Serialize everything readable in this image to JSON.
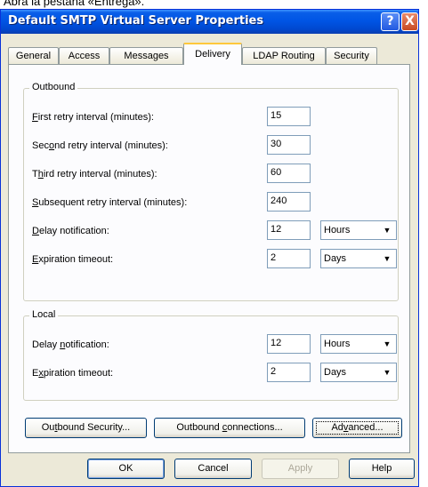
{
  "caption": "Abra la pestaña «Entrega».",
  "window": {
    "title": "Default SMTP Virtual Server Properties",
    "help_glyph": "?",
    "close_glyph": "X"
  },
  "tabs": [
    "General",
    "Access",
    "Messages",
    "Delivery",
    "LDAP Routing",
    "Security"
  ],
  "active_tab": "Delivery",
  "outbound": {
    "group_label": "Outbound",
    "first_retry": {
      "label_u": "F",
      "label_rest": "irst retry interval (minutes):",
      "value": "15"
    },
    "second_retry": {
      "label_pre": "Sec",
      "label_u": "o",
      "label_rest": "nd retry interval (minutes):",
      "value": "30"
    },
    "third_retry": {
      "label_pre": "T",
      "label_u": "h",
      "label_rest": "ird retry interval (minutes):",
      "value": "60"
    },
    "subsequent_retry": {
      "label_u": "S",
      "label_rest": "ubsequent retry interval (minutes):",
      "value": "240"
    },
    "delay_notification": {
      "label_u": "D",
      "label_rest": "elay notification:",
      "value": "12",
      "unit": "Hours"
    },
    "expiration_timeout": {
      "label_u": "E",
      "label_rest": "xpiration timeout:",
      "value": "2",
      "unit": "Days"
    }
  },
  "local": {
    "group_label": "Local",
    "delay_notification": {
      "label_pre": "Delay ",
      "label_u": "n",
      "label_rest": "otification:",
      "value": "12",
      "unit": "Hours"
    },
    "expiration_timeout": {
      "label_pre": "E",
      "label_u": "x",
      "label_rest": "piration timeout:",
      "value": "2",
      "unit": "Days"
    }
  },
  "panel_buttons": {
    "outbound_security": {
      "pre": "Ou",
      "u": "t",
      "rest": "bound Security..."
    },
    "outbound_connections": {
      "pre": "Outbound ",
      "u": "c",
      "rest": "onnections..."
    },
    "advanced": {
      "pre": "Ad",
      "u": "v",
      "rest": "anced..."
    }
  },
  "dialog_buttons": {
    "ok": "OK",
    "cancel": "Cancel",
    "apply": "Apply",
    "help": "Help"
  },
  "combo_arrow_glyph": "▼"
}
